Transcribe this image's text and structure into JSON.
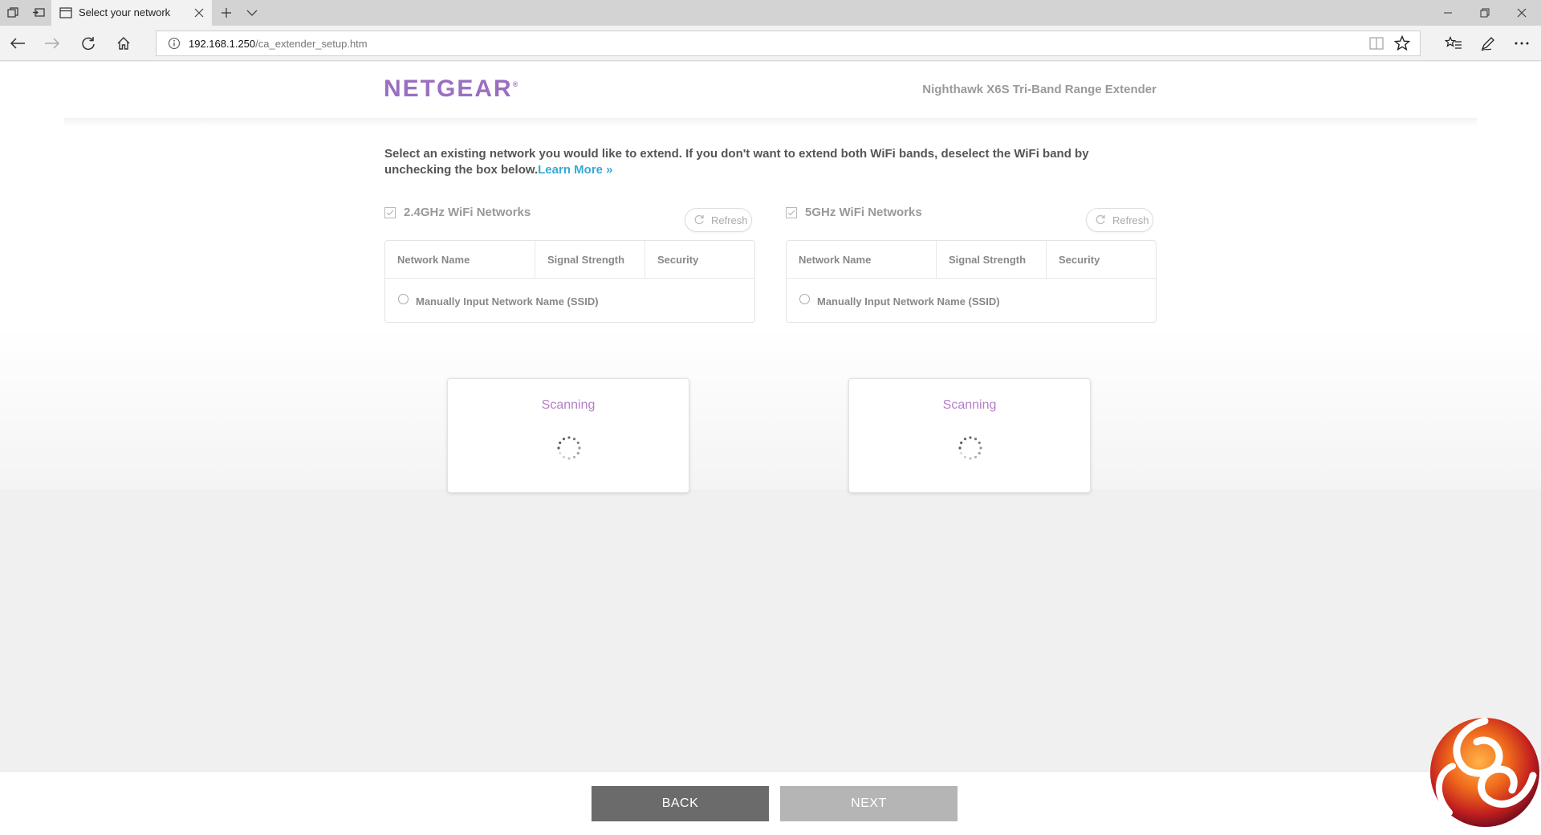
{
  "browser": {
    "tab_title": "Select your network",
    "address_host": "192.168.1.250",
    "address_path": "/ca_extender_setup.htm"
  },
  "header": {
    "logo_text": "NETGEAR",
    "logo_mark": "®",
    "product_name": "Nighthawk X6S Tri-Band Range Extender"
  },
  "intro": {
    "text": "Select an existing network you would like to extend. If you don't want to extend both WiFi bands, deselect the WiFi band by unchecking the box below.",
    "link": "Learn More »"
  },
  "bands": [
    {
      "label": "2.4GHz WiFi Networks",
      "checked": true,
      "refresh_label": "Refresh",
      "columns": [
        "Network Name",
        "Signal Strength",
        "Security"
      ],
      "manual_option": "Manually Input Network Name (SSID)",
      "status": "Scanning"
    },
    {
      "label": "5GHz WiFi Networks",
      "checked": true,
      "refresh_label": "Refresh",
      "columns": [
        "Network Name",
        "Signal Strength",
        "Security"
      ],
      "manual_option": "Manually Input Network Name (SSID)",
      "status": "Scanning"
    }
  ],
  "footer": {
    "back_label": "BACK",
    "next_label": "NEXT"
  },
  "colors": {
    "brand_purple": "#9b6fbf",
    "link_blue": "#37a9d6",
    "back_button": "#6b6b6b",
    "next_button_disabled": "#b5b5b5"
  },
  "icons": [
    "tab-manager-icon",
    "set-aside-tabs-icon",
    "page-icon",
    "close-icon",
    "new-tab-icon",
    "chevron-down-icon",
    "minimize-icon",
    "restore-icon",
    "back-arrow-icon",
    "forward-arrow-icon",
    "reload-icon",
    "home-icon",
    "info-icon",
    "reading-view-icon",
    "favorite-star-icon",
    "favorites-hub-icon",
    "pen-icon",
    "more-icon",
    "refresh-icon",
    "spinner-icon"
  ]
}
